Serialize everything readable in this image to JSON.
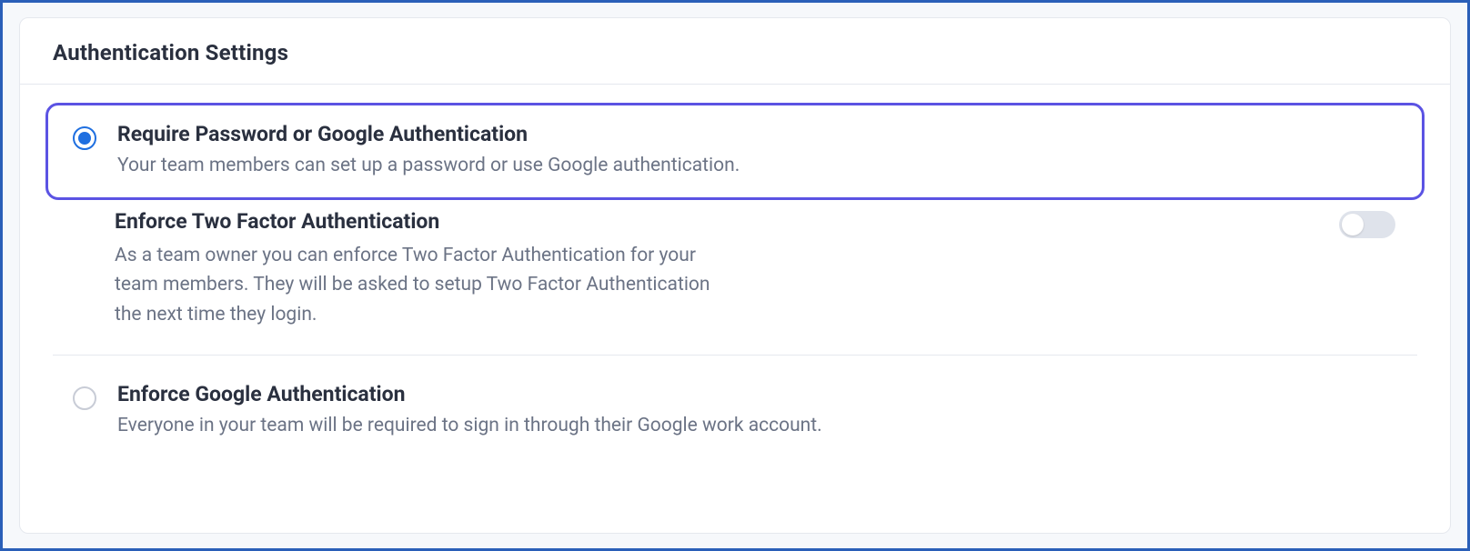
{
  "panel": {
    "title": "Authentication Settings"
  },
  "options": [
    {
      "title": "Require Password or Google Authentication",
      "description": "Your team members can set up a password or use Google authentication.",
      "selected": true
    },
    {
      "title": "Enforce Google Authentication",
      "description": "Everyone in your team will be required to sign in through their Google work account.",
      "selected": false
    }
  ],
  "twofa": {
    "title": "Enforce Two Factor Authentication",
    "description": "As a team owner you can enforce Two Factor Authentication for your team members. They will be asked to setup Two Factor Authentication the next time they login.",
    "enabled": false
  }
}
